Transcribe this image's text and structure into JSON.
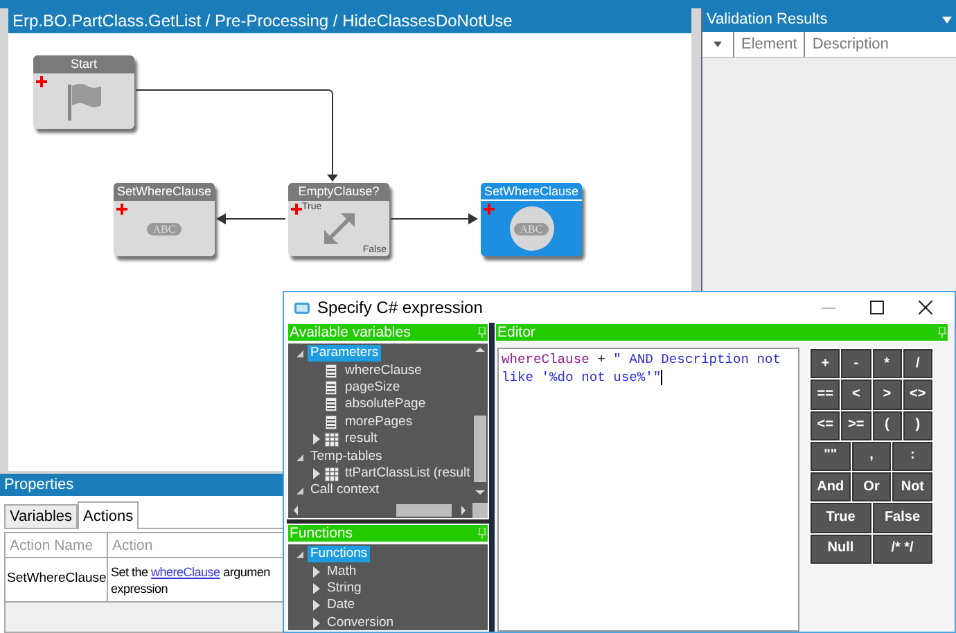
{
  "designer": {
    "title": "Erp.BO.PartClass.GetList / Pre-Processing / HideClassesDoNotUse",
    "nodes": [
      {
        "label": "Start",
        "kind": "start",
        "selected": false
      },
      {
        "label": "SetWhereClause",
        "kind": "action",
        "badge": "ABC",
        "selected": false
      },
      {
        "label": "EmptyClause?",
        "kind": "condition",
        "true_label": "True",
        "false_label": "False",
        "selected": false
      },
      {
        "label": "SetWhereClause",
        "kind": "action",
        "badge": "ABC",
        "selected": true
      }
    ]
  },
  "properties": {
    "title": "Properties",
    "tabs": [
      {
        "label": "Variables",
        "selected": false
      },
      {
        "label": "Actions",
        "selected": true
      }
    ],
    "columns": [
      "Action Name",
      "Action"
    ],
    "rows": [
      {
        "name": "SetWhereClause",
        "action_before": "Set the ",
        "action_link": "whereClause",
        "action_after": " argumen",
        "action_line2": "expression"
      }
    ]
  },
  "validation": {
    "title": "Validation Results",
    "columns": [
      "Element",
      "Description"
    ]
  },
  "dialog": {
    "title": "Specify C# expression",
    "variables": {
      "title": "Available variables",
      "tree": [
        {
          "label": "Parameters",
          "expanded": true,
          "selected": true,
          "children": [
            {
              "label": "whereClause",
              "kind": "field",
              "selected": false
            },
            {
              "label": "pageSize",
              "kind": "field",
              "selected": false
            },
            {
              "label": "absolutePage",
              "kind": "field",
              "selected": false
            },
            {
              "label": "morePages",
              "kind": "field",
              "selected": false
            },
            {
              "label": "result",
              "kind": "table",
              "expanded": false,
              "selected": false
            }
          ]
        },
        {
          "label": "Temp-tables",
          "expanded": true,
          "selected": false,
          "children": [
            {
              "label": "ttPartClassList (result",
              "kind": "table",
              "expanded": false,
              "selected": false
            }
          ]
        },
        {
          "label": "Call context",
          "expanded": true,
          "selected": false
        }
      ]
    },
    "functions": {
      "title": "Functions",
      "tree": [
        {
          "label": "Functions",
          "expanded": true,
          "selected": true,
          "children": [
            {
              "label": "Math",
              "expanded": false,
              "selected": false
            },
            {
              "label": "String",
              "expanded": false,
              "selected": false
            },
            {
              "label": "Date",
              "expanded": false,
              "selected": false
            },
            {
              "label": "Conversion",
              "expanded": false,
              "selected": false
            }
          ]
        }
      ]
    },
    "editor": {
      "title": "Editor",
      "code": [
        {
          "text": "whereClause",
          "kind": "identifier"
        },
        {
          "text": " + ",
          "kind": "operator"
        },
        {
          "text": "\" AND Description not like '%do not use%'\"",
          "kind": "string"
        }
      ]
    },
    "operator_rows": [
      [
        "+",
        "-",
        "*",
        "/"
      ],
      [
        "==",
        "<",
        ">",
        "<>"
      ],
      [
        "<=",
        ">=",
        "(",
        ")"
      ],
      [
        "\"\"",
        ",",
        ":"
      ],
      [
        "And",
        "Or",
        "Not"
      ],
      [
        "True",
        "False"
      ],
      [
        "Null",
        "/* */"
      ]
    ]
  }
}
